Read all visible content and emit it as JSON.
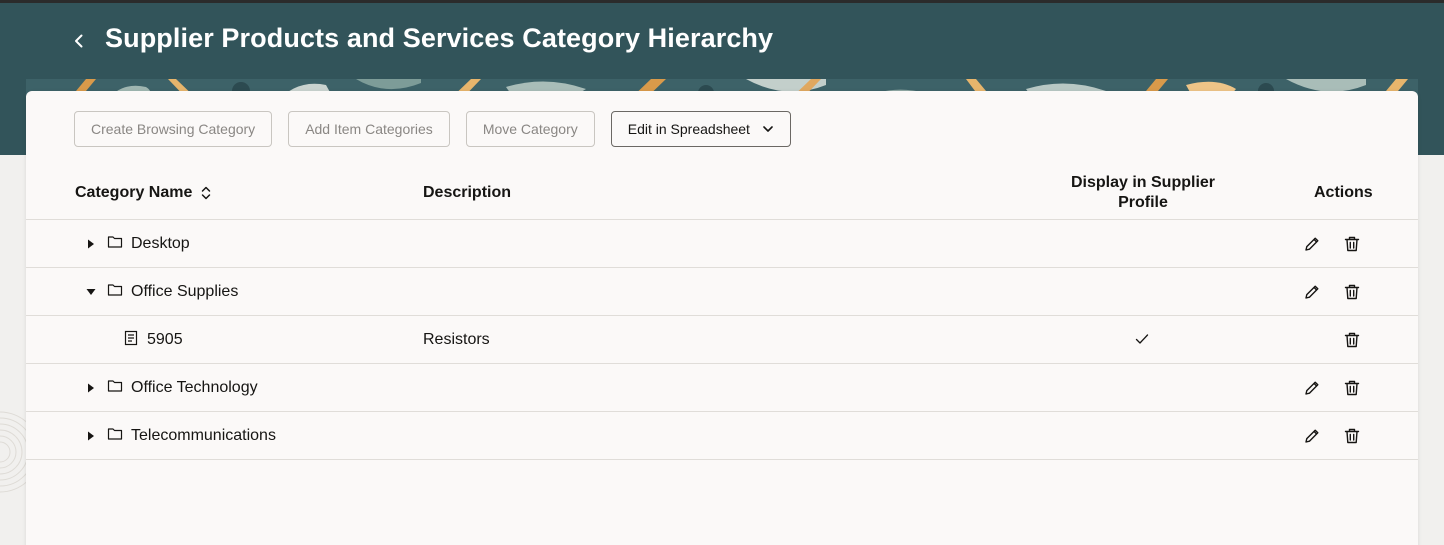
{
  "header": {
    "title": "Supplier Products and Services Category Hierarchy",
    "back_icon": "chevron-left-icon"
  },
  "toolbar": {
    "create_browsing_category": "Create Browsing Category",
    "add_item_categories": "Add Item Categories",
    "move_category": "Move Category",
    "edit_in_spreadsheet": "Edit in Spreadsheet"
  },
  "table": {
    "columns": {
      "category_name": "Category Name",
      "description": "Description",
      "display_in_supplier_profile": "Display in Supplier Profile",
      "actions": "Actions"
    },
    "rows": [
      {
        "name": "Desktop",
        "description": "",
        "type": "folder",
        "expanded": false,
        "level": 0,
        "display_in_profile": false,
        "editable": true
      },
      {
        "name": "Office Supplies",
        "description": "",
        "type": "folder",
        "expanded": true,
        "level": 0,
        "display_in_profile": false,
        "editable": true
      },
      {
        "name": "5905",
        "description": "Resistors",
        "type": "item",
        "level": 1,
        "display_in_profile": true,
        "editable": false
      },
      {
        "name": "Office Technology",
        "description": "",
        "type": "folder",
        "expanded": false,
        "level": 0,
        "display_in_profile": false,
        "editable": true
      },
      {
        "name": "Telecommunications",
        "description": "",
        "type": "folder",
        "expanded": false,
        "level": 0,
        "display_in_profile": false,
        "editable": true
      }
    ]
  },
  "colors": {
    "header_bg": "#32545a",
    "page_bg": "#f1f0ee",
    "panel_bg": "#fbf9f8",
    "text": "#161513",
    "disabled_text": "#8a8784",
    "banner_accent": "#e7b56c"
  }
}
